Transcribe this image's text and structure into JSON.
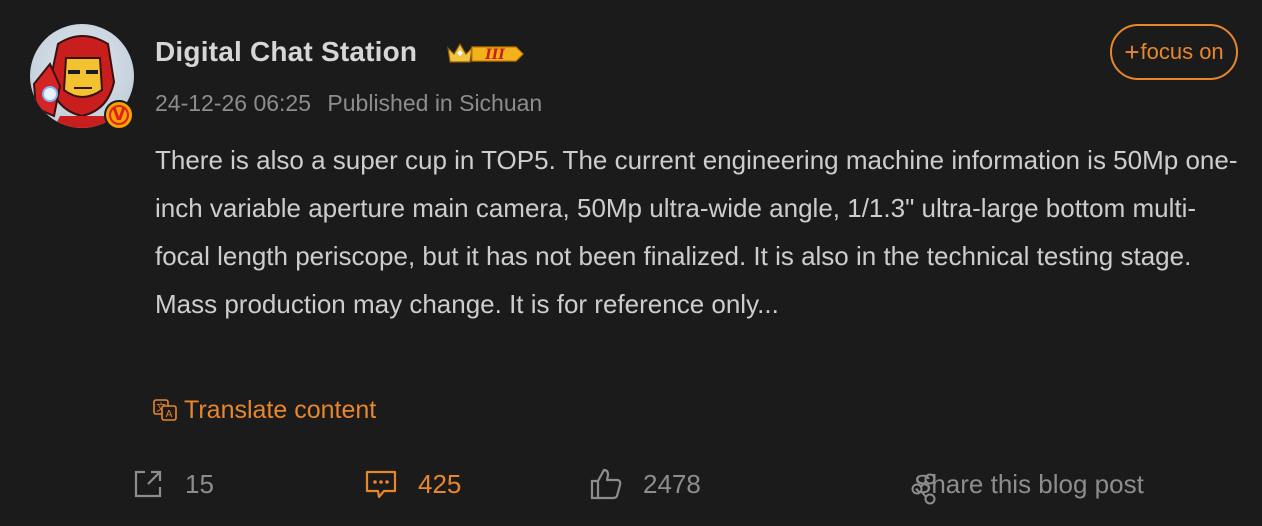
{
  "post": {
    "author": "Digital Chat Station",
    "level_badge": "III",
    "verified_badge": "V",
    "timestamp": "24-12-26 06:25",
    "location": "Published in Sichuan",
    "follow_label": "focus on",
    "follow_plus": "+",
    "body": "There is also a super cup in TOP5. The current engineering machine information is 50Mp one-inch variable aperture main camera, 50Mp ultra-wide angle, 1/1.3\" ultra-large bottom multi-focal length periscope, but it has not been finalized. It is also in the technical testing stage. Mass production may change. It is for reference only...",
    "translate_label": "Translate content"
  },
  "actions": {
    "repost_count": "15",
    "comment_count": "425",
    "like_count": "2478",
    "share_label": "Share this blog post"
  },
  "colors": {
    "background": "#1b1b1b",
    "accent": "#e8862c",
    "text": "#cdcdcd",
    "muted": "#8d8d8d"
  },
  "icons": {
    "repost": "repost-icon",
    "comment": "comment-icon",
    "like": "thumbs-up-icon",
    "share": "share-icon",
    "translate": "translate-icon",
    "crown": "crown-icon"
  }
}
